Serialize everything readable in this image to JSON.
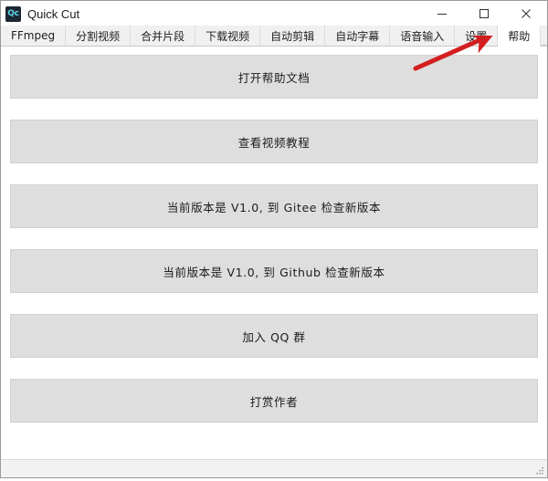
{
  "window": {
    "title": "Quick Cut",
    "icon_label": "Qc",
    "icon_name": "app-icon-quickcut",
    "controls": {
      "minimize": "minimize-icon",
      "maximize": "maximize-icon",
      "close": "close-icon"
    }
  },
  "tabs": [
    {
      "label": "FFmpeg",
      "active": false
    },
    {
      "label": "分割视频",
      "active": false
    },
    {
      "label": "合并片段",
      "active": false
    },
    {
      "label": "下载视频",
      "active": false
    },
    {
      "label": "自动剪辑",
      "active": false
    },
    {
      "label": "自动字幕",
      "active": false
    },
    {
      "label": "语音输入",
      "active": false
    },
    {
      "label": "设置",
      "active": false
    },
    {
      "label": "帮助",
      "active": true
    }
  ],
  "content": {
    "buttons": [
      {
        "label": "打开帮助文档",
        "name": "open-help-doc-button"
      },
      {
        "label": "查看视频教程",
        "name": "view-video-tutorial-button"
      },
      {
        "label": "当前版本是 V1.0, 到 Gitee 检查新版本",
        "name": "check-update-gitee-button"
      },
      {
        "label": "当前版本是 V1.0, 到 Github 检查新版本",
        "name": "check-update-github-button"
      },
      {
        "label": "加入 QQ 群",
        "name": "join-qq-group-button"
      },
      {
        "label": "打赏作者",
        "name": "donate-author-button"
      }
    ]
  },
  "annotation": {
    "arrow_color": "#d31f1f",
    "arrow_target_tab": "帮助"
  },
  "colors": {
    "button_fill": "#dedede",
    "tabbar_bg": "#f0f0f0",
    "active_tab_bg": "#ffffff",
    "window_border": "#9a9a9a",
    "statusbar_bg": "#f2f2f2",
    "icon_bg": "#1c2733",
    "icon_fg": "#5fd7e8"
  }
}
